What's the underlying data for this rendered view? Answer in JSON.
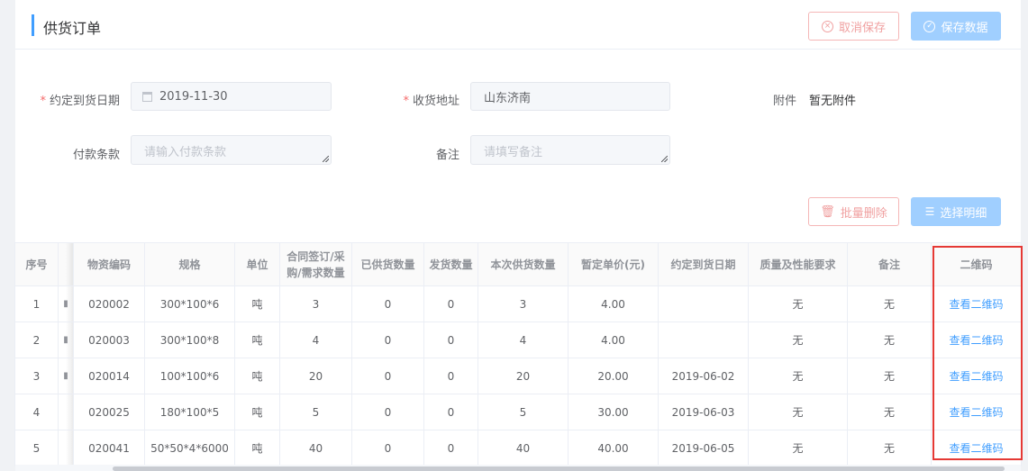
{
  "header": {
    "title": "供货订单",
    "cancel_label": "取消保存",
    "save_label": "保存数据"
  },
  "form": {
    "agreed_date_label": "约定到货日期",
    "agreed_date_value": "2019-11-30",
    "address_label": "收货地址",
    "address_value": "山东济南",
    "attachment_label": "附件",
    "attachment_value": "暂无附件",
    "payment_label": "付款条款",
    "payment_placeholder": "请输入付款条款",
    "remark_label": "备注",
    "remark_placeholder": "请填写备注"
  },
  "toolbar": {
    "batch_delete_label": "批量删除",
    "select_detail_label": "选择明细"
  },
  "table": {
    "headers": [
      "序号",
      "",
      "物资编码",
      "规格",
      "单位",
      "合同签订/采购/需求数量",
      "已供货数量",
      "发货数量",
      "本次供货数量",
      "暂定单价(元)",
      "约定到货日期",
      "质量及性能要求",
      "备注",
      "二维码"
    ],
    "rows": [
      {
        "no": "1",
        "mark": "▮",
        "code": "020002",
        "spec": "300*100*6",
        "unit": "吨",
        "contract_qty": "3",
        "supplied_qty": "0",
        "shipped_qty": "0",
        "this_qty": "3",
        "price": "4.00",
        "date": "",
        "quality": "无",
        "remark": "无",
        "qr": "查看二维码"
      },
      {
        "no": "2",
        "mark": "▮",
        "code": "020003",
        "spec": "300*100*8",
        "unit": "吨",
        "contract_qty": "4",
        "supplied_qty": "0",
        "shipped_qty": "0",
        "this_qty": "4",
        "price": "4.00",
        "date": "",
        "quality": "无",
        "remark": "无",
        "qr": "查看二维码"
      },
      {
        "no": "3",
        "mark": "▮",
        "code": "020014",
        "spec": "100*100*6",
        "unit": "吨",
        "contract_qty": "20",
        "supplied_qty": "0",
        "shipped_qty": "0",
        "this_qty": "20",
        "price": "20.00",
        "date": "2019-06-02",
        "quality": "无",
        "remark": "无",
        "qr": "查看二维码"
      },
      {
        "no": "4",
        "mark": "",
        "code": "020025",
        "spec": "180*100*5",
        "unit": "吨",
        "contract_qty": "5",
        "supplied_qty": "0",
        "shipped_qty": "0",
        "this_qty": "5",
        "price": "30.00",
        "date": "2019-06-03",
        "quality": "无",
        "remark": "无",
        "qr": "查看二维码"
      },
      {
        "no": "5",
        "mark": "",
        "code": "020041",
        "spec": "50*50*4*6000",
        "unit": "吨",
        "contract_qty": "40",
        "supplied_qty": "0",
        "shipped_qty": "0",
        "this_qty": "40",
        "price": "40.00",
        "date": "2019-06-05",
        "quality": "无",
        "remark": "无",
        "qr": "查看二维码"
      }
    ]
  },
  "colors": {
    "accent": "#409eff",
    "danger": "#f56c6c",
    "highlight_box": "#e53935"
  }
}
